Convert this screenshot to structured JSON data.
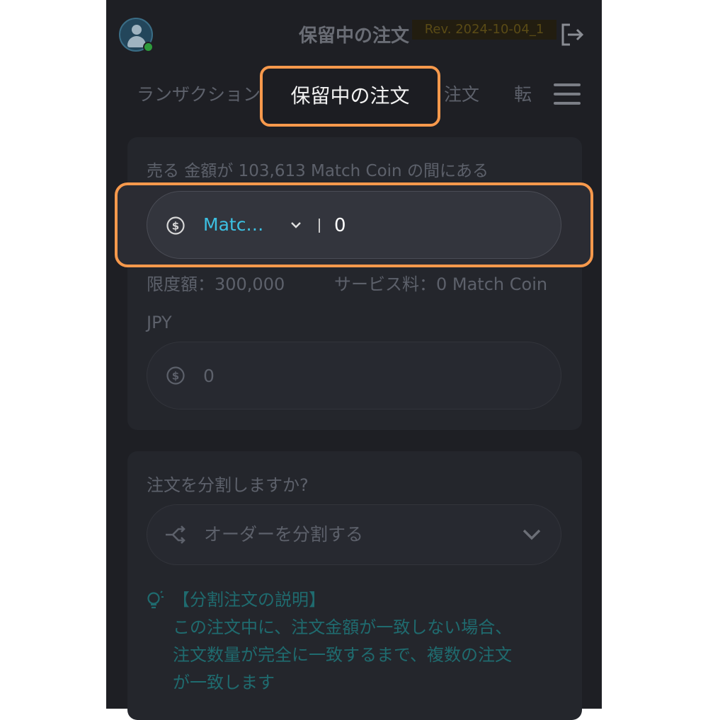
{
  "header": {
    "title": "保留中の注文",
    "revision": "Rev. 2024-10-04_1",
    "avatar_icon": "user-avatar-icon",
    "logout_icon": "logout-icon"
  },
  "tabs": {
    "transactions": "ランザクション",
    "pending": "保留中の注文",
    "orders": "注文",
    "transfer": "転",
    "menu_icon": "hamburger-menu-icon"
  },
  "sell_form": {
    "range_label": "売る 金額が 103,613 Match Coin の間にある",
    "currency_select": "Matc…",
    "amount_value": "0",
    "limit_text": "限度額：300,000",
    "fee_text": "サービス料：0 Match Coin",
    "jpy_label": "JPY",
    "jpy_value": "0"
  },
  "split": {
    "question": "注文を分割しますか?",
    "select_value": "オーダーを分割する",
    "info_title": "【分割注文の説明】",
    "info_lines": [
      "この注文中に、注文金額が一致しない場合、",
      "注文数量が完全に一致するまで、複数の注文",
      "が一致します"
    ]
  },
  "colors": {
    "highlight": "#f7994c",
    "accent_cyan": "#3cc0e2",
    "teal_text": "#1f6b6f",
    "background": "#1e1f24"
  }
}
